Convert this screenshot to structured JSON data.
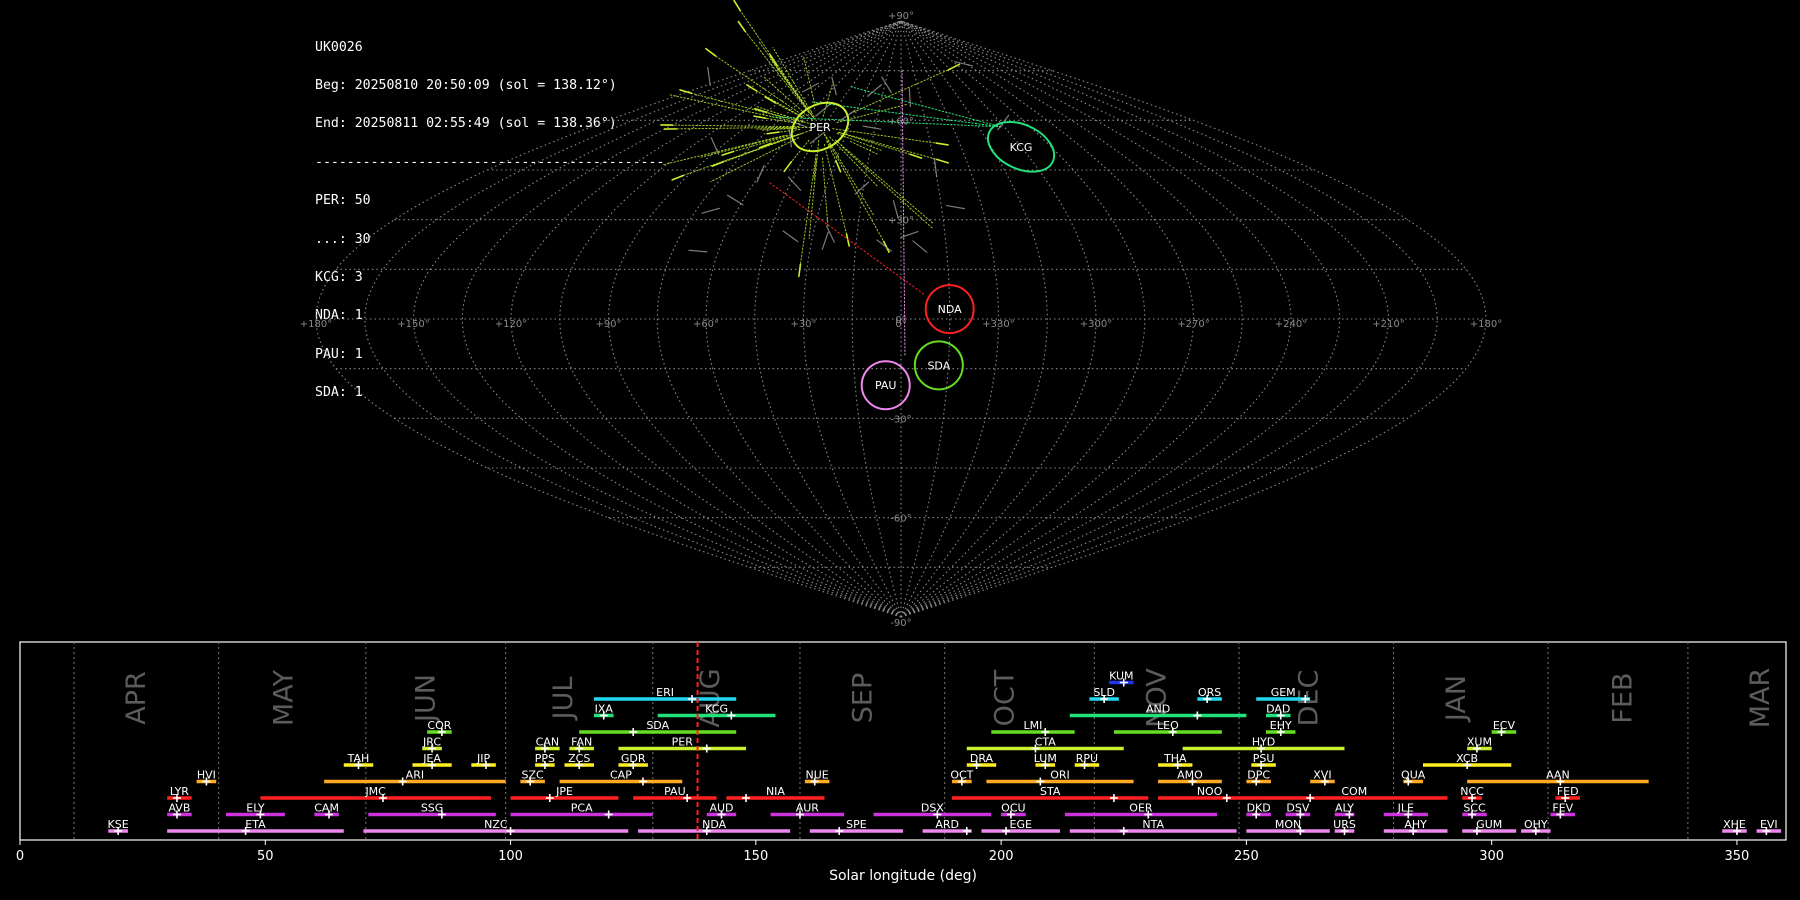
{
  "info": {
    "station": "UK0026",
    "begin": "Beg: 20250810 20:50:09 (sol = 138.12°)",
    "end": "End: 20250811 02:55:49 (sol = 138.36°)",
    "separator": "--------------------------------------------",
    "counts": [
      "PER: 50",
      "...: 30",
      "KCG: 3",
      "NDA: 1",
      "PAU: 1",
      "SDA: 1"
    ]
  },
  "sky_map": {
    "projection": "sinusoidal",
    "lat_labels": [
      "+90°",
      "+60°",
      "+30°",
      "0°",
      "-30°",
      "-60°",
      "-90°"
    ],
    "lon_labels": [
      "+180°",
      "+150°",
      "+120°",
      "+90°",
      "+60°",
      "+30°",
      "0°",
      "+330°",
      "+300°",
      "+270°",
      "+240°",
      "+210°",
      "+180°"
    ],
    "radiants": [
      {
        "name": "PER",
        "color": "#c8f02c",
        "lon": 47,
        "lat": 58
      },
      {
        "name": "KCG",
        "color": "#22e07a",
        "lon": 300,
        "lat": 52
      },
      {
        "name": "NDA",
        "color": "#ff2020",
        "lon": 345,
        "lat": 3
      },
      {
        "name": "SDA",
        "color": "#66dd22",
        "lon": 348,
        "lat": -14
      },
      {
        "name": "PAU",
        "color": "#ee88ee",
        "lon": 5,
        "lat": -20
      }
    ]
  },
  "chart_data": {
    "type": "timeline",
    "xlabel": "Solar longitude (deg)",
    "xlim": [
      0,
      360
    ],
    "xticks": [
      "0",
      "50",
      "100",
      "150",
      "200",
      "250",
      "300",
      "350"
    ],
    "current_sol": 138.12,
    "months": [
      {
        "label": "APR",
        "sol": 24
      },
      {
        "label": "MAY",
        "sol": 54
      },
      {
        "label": "JUN",
        "sol": 83
      },
      {
        "label": "JUL",
        "sol": 111
      },
      {
        "label": "AUG",
        "sol": 141
      },
      {
        "label": "SEP",
        "sol": 172
      },
      {
        "label": "OCT",
        "sol": 201
      },
      {
        "label": "NOV",
        "sol": 232
      },
      {
        "label": "DEC",
        "sol": 263
      },
      {
        "label": "JAN",
        "sol": 293
      },
      {
        "label": "FEB",
        "sol": 327
      },
      {
        "label": "MAR",
        "sol": 355
      }
    ],
    "month_bounds": [
      11,
      40.5,
      70.5,
      99,
      129,
      159,
      188.5,
      219,
      248.5,
      280,
      311.5,
      340
    ],
    "showers": [
      {
        "name": "KUM",
        "start": 222,
        "end": 227,
        "peak": 225,
        "row": 10,
        "color": "#2233ee"
      },
      {
        "name": "ERI",
        "start": 117,
        "end": 146,
        "peak": 137,
        "row": 9,
        "color": "#22d8f0"
      },
      {
        "name": "SLD",
        "start": 218,
        "end": 224,
        "peak": 221,
        "row": 9,
        "color": "#22d8f0"
      },
      {
        "name": "ORS",
        "start": 240,
        "end": 245,
        "peak": 242,
        "row": 9,
        "color": "#22d8f0"
      },
      {
        "name": "GEM",
        "start": 252,
        "end": 263,
        "peak": 262,
        "row": 9,
        "color": "#22d8f0"
      },
      {
        "name": "IXA",
        "start": 117,
        "end": 121,
        "peak": 119,
        "row": 8,
        "color": "#22e07a"
      },
      {
        "name": "KCG",
        "start": 130,
        "end": 154,
        "peak": 145,
        "row": 8,
        "color": "#22e07a"
      },
      {
        "name": "AND",
        "start": 214,
        "end": 250,
        "peak": 240,
        "row": 8,
        "color": "#22e07a"
      },
      {
        "name": "DAD",
        "start": 254,
        "end": 259,
        "peak": 257,
        "row": 8,
        "color": "#22e07a"
      },
      {
        "name": "COR",
        "start": 83,
        "end": 88,
        "peak": 86,
        "row": 7,
        "color": "#66dd22"
      },
      {
        "name": "SDA",
        "start": 114,
        "end": 146,
        "peak": 125,
        "row": 7,
        "color": "#66dd22"
      },
      {
        "name": "LMI",
        "start": 198,
        "end": 215,
        "peak": 209,
        "row": 7,
        "color": "#66dd22"
      },
      {
        "name": "LEO",
        "start": 223,
        "end": 245,
        "peak": 235,
        "row": 7,
        "color": "#66dd22"
      },
      {
        "name": "EHY",
        "start": 254,
        "end": 260,
        "peak": 257,
        "row": 7,
        "color": "#66dd22"
      },
      {
        "name": "ECV",
        "start": 300,
        "end": 305,
        "peak": 302,
        "row": 7,
        "color": "#66dd22"
      },
      {
        "name": "JRC",
        "start": 82,
        "end": 86,
        "peak": 84,
        "row": 6,
        "color": "#c8f02c"
      },
      {
        "name": "CAN",
        "start": 105,
        "end": 110,
        "peak": 107,
        "row": 6,
        "color": "#c8f02c"
      },
      {
        "name": "FAN",
        "start": 112,
        "end": 117,
        "peak": 114,
        "row": 6,
        "color": "#c8f02c"
      },
      {
        "name": "PER",
        "start": 122,
        "end": 148,
        "peak": 140,
        "row": 6,
        "color": "#c8f02c"
      },
      {
        "name": "CTA",
        "start": 193,
        "end": 225,
        "peak": 207,
        "row": 6,
        "color": "#c8f02c"
      },
      {
        "name": "HYD",
        "start": 237,
        "end": 270,
        "peak": 253,
        "row": 6,
        "color": "#c8f02c"
      },
      {
        "name": "XUM",
        "start": 295,
        "end": 300,
        "peak": 297,
        "row": 6,
        "color": "#c8f02c"
      },
      {
        "name": "TAH",
        "start": 66,
        "end": 72,
        "peak": 69,
        "row": 5,
        "color": "#ffee22"
      },
      {
        "name": "JEA",
        "start": 80,
        "end": 88,
        "peak": 84,
        "row": 5,
        "color": "#ffee22"
      },
      {
        "name": "JIP",
        "start": 92,
        "end": 97,
        "peak": 95,
        "row": 5,
        "color": "#ffee22"
      },
      {
        "name": "PPS",
        "start": 105,
        "end": 109,
        "peak": 107,
        "row": 5,
        "color": "#ffee22"
      },
      {
        "name": "ZCS",
        "start": 111,
        "end": 117,
        "peak": 114,
        "row": 5,
        "color": "#ffee22"
      },
      {
        "name": "GDR",
        "start": 122,
        "end": 128,
        "peak": 125,
        "row": 5,
        "color": "#ffee22"
      },
      {
        "name": "DRA",
        "start": 193,
        "end": 199,
        "peak": 195,
        "row": 5,
        "color": "#ffee22"
      },
      {
        "name": "LUM",
        "start": 207,
        "end": 211,
        "peak": 209,
        "row": 5,
        "color": "#ffee22"
      },
      {
        "name": "RPU",
        "start": 215,
        "end": 220,
        "peak": 217,
        "row": 5,
        "color": "#ffee22"
      },
      {
        "name": "THA",
        "start": 232,
        "end": 239,
        "peak": 236,
        "row": 5,
        "color": "#ffee22"
      },
      {
        "name": "PSU",
        "start": 251,
        "end": 256,
        "peak": 253,
        "row": 5,
        "color": "#ffee22"
      },
      {
        "name": "XCB",
        "start": 286,
        "end": 304,
        "peak": 295,
        "row": 5,
        "color": "#ffee22"
      },
      {
        "name": "HVI",
        "start": 36,
        "end": 40,
        "peak": 38,
        "row": 4,
        "color": "#ffaa22"
      },
      {
        "name": "ARI",
        "start": 62,
        "end": 99,
        "peak": 78,
        "row": 4,
        "color": "#ffaa22"
      },
      {
        "name": "SZC",
        "start": 102,
        "end": 107,
        "peak": 104,
        "row": 4,
        "color": "#ffaa22"
      },
      {
        "name": "CAP",
        "start": 110,
        "end": 135,
        "peak": 127,
        "row": 4,
        "color": "#ffaa22"
      },
      {
        "name": "NUE",
        "start": 160,
        "end": 165,
        "peak": 162,
        "row": 4,
        "color": "#ffaa22"
      },
      {
        "name": "OCT",
        "start": 190,
        "end": 194,
        "peak": 192,
        "row": 4,
        "color": "#ffaa22"
      },
      {
        "name": "ORI",
        "start": 197,
        "end": 227,
        "peak": 208,
        "row": 4,
        "color": "#ffaa22"
      },
      {
        "name": "AMO",
        "start": 232,
        "end": 245,
        "peak": 239,
        "row": 4,
        "color": "#ffaa22"
      },
      {
        "name": "DPC",
        "start": 250,
        "end": 255,
        "peak": 252,
        "row": 4,
        "color": "#ffaa22"
      },
      {
        "name": "XVI",
        "start": 263,
        "end": 268,
        "peak": 266,
        "row": 4,
        "color": "#ffaa22"
      },
      {
        "name": "QUA",
        "start": 282,
        "end": 286,
        "peak": 283,
        "row": 4,
        "color": "#ffaa22"
      },
      {
        "name": "AAN",
        "start": 295,
        "end": 332,
        "peak": 314,
        "row": 4,
        "color": "#ffaa22"
      },
      {
        "name": "LYR",
        "start": 30,
        "end": 35,
        "peak": 32,
        "row": 3,
        "color": "#ff2020"
      },
      {
        "name": "JMC",
        "start": 49,
        "end": 96,
        "peak": 74,
        "row": 3,
        "color": "#ff2020"
      },
      {
        "name": "JPE",
        "start": 100,
        "end": 122,
        "peak": 108,
        "row": 3,
        "color": "#ff2020"
      },
      {
        "name": "PAU",
        "start": 125,
        "end": 142,
        "peak": 136,
        "row": 3,
        "color": "#ff2020"
      },
      {
        "name": "NIA",
        "start": 144,
        "end": 164,
        "peak": 148,
        "row": 3,
        "color": "#ff2020"
      },
      {
        "name": "STA",
        "start": 190,
        "end": 230,
        "peak": 223,
        "row": 3,
        "color": "#ff2020"
      },
      {
        "name": "NOO",
        "start": 232,
        "end": 253,
        "peak": 246,
        "row": 3,
        "color": "#ff2020"
      },
      {
        "name": "COM",
        "start": 253,
        "end": 291,
        "peak": 263,
        "row": 3,
        "color": "#ff2020"
      },
      {
        "name": "NCC",
        "start": 294,
        "end": 298,
        "peak": 296,
        "row": 3,
        "color": "#ff2020"
      },
      {
        "name": "FED",
        "start": 313,
        "end": 318,
        "peak": 315,
        "row": 3,
        "color": "#ff2020"
      },
      {
        "name": "AVB",
        "start": 30,
        "end": 35,
        "peak": 32,
        "row": 2,
        "color": "#cc33dd"
      },
      {
        "name": "ELY",
        "start": 42,
        "end": 54,
        "peak": 49,
        "row": 2,
        "color": "#cc33dd"
      },
      {
        "name": "CAM",
        "start": 60,
        "end": 65,
        "peak": 63,
        "row": 2,
        "color": "#cc33dd"
      },
      {
        "name": "SSG",
        "start": 71,
        "end": 97,
        "peak": 86,
        "row": 2,
        "color": "#cc33dd"
      },
      {
        "name": "PCA",
        "start": 100,
        "end": 129,
        "peak": 120,
        "row": 2,
        "color": "#cc33dd"
      },
      {
        "name": "AUD",
        "start": 140,
        "end": 146,
        "peak": 143,
        "row": 2,
        "color": "#cc33dd"
      },
      {
        "name": "AUR",
        "start": 153,
        "end": 168,
        "peak": 159,
        "row": 2,
        "color": "#cc33dd"
      },
      {
        "name": "DSX",
        "start": 174,
        "end": 198,
        "peak": 187,
        "row": 2,
        "color": "#cc33dd"
      },
      {
        "name": "OCU",
        "start": 200,
        "end": 205,
        "peak": 202,
        "row": 2,
        "color": "#cc33dd"
      },
      {
        "name": "OER",
        "start": 213,
        "end": 244,
        "peak": 230,
        "row": 2,
        "color": "#cc33dd"
      },
      {
        "name": "DKD",
        "start": 250,
        "end": 255,
        "peak": 252,
        "row": 2,
        "color": "#cc33dd"
      },
      {
        "name": "DSV",
        "start": 258,
        "end": 263,
        "peak": 261,
        "row": 2,
        "color": "#cc33dd"
      },
      {
        "name": "ALY",
        "start": 268,
        "end": 272,
        "peak": 271,
        "row": 2,
        "color": "#cc33dd"
      },
      {
        "name": "JLE",
        "start": 278,
        "end": 287,
        "peak": 283,
        "row": 2,
        "color": "#cc33dd"
      },
      {
        "name": "SCC",
        "start": 294,
        "end": 299,
        "peak": 296,
        "row": 2,
        "color": "#cc33dd"
      },
      {
        "name": "FEV",
        "start": 312,
        "end": 317,
        "peak": 314,
        "row": 2,
        "color": "#cc33dd"
      },
      {
        "name": "KSE",
        "start": 18,
        "end": 22,
        "peak": 20,
        "row": 1,
        "color": "#ee88ee"
      },
      {
        "name": "ETA",
        "start": 30,
        "end": 66,
        "peak": 46,
        "row": 1,
        "color": "#ee88ee"
      },
      {
        "name": "NZC",
        "start": 70,
        "end": 124,
        "peak": 100,
        "row": 1,
        "color": "#ee88ee"
      },
      {
        "name": "NDA",
        "start": 126,
        "end": 157,
        "peak": 140,
        "row": 1,
        "color": "#ee88ee"
      },
      {
        "name": "SPE",
        "start": 161,
        "end": 180,
        "peak": 167,
        "row": 1,
        "color": "#ee88ee"
      },
      {
        "name": "ARD",
        "start": 184,
        "end": 194,
        "peak": 193,
        "row": 1,
        "color": "#ee88ee"
      },
      {
        "name": "EGE",
        "start": 196,
        "end": 212,
        "peak": 201,
        "row": 1,
        "color": "#ee88ee"
      },
      {
        "name": "NTA",
        "start": 214,
        "end": 248,
        "peak": 225,
        "row": 1,
        "color": "#ee88ee"
      },
      {
        "name": "MON",
        "start": 250,
        "end": 267,
        "peak": 261,
        "row": 1,
        "color": "#ee88ee"
      },
      {
        "name": "URS",
        "start": 268,
        "end": 272,
        "peak": 270,
        "row": 1,
        "color": "#ee88ee"
      },
      {
        "name": "AHY",
        "start": 278,
        "end": 291,
        "peak": 284,
        "row": 1,
        "color": "#ee88ee"
      },
      {
        "name": "GUM",
        "start": 294,
        "end": 305,
        "peak": 297,
        "row": 1,
        "color": "#ee88ee"
      },
      {
        "name": "OHY",
        "start": 306,
        "end": 312,
        "peak": 309,
        "row": 1,
        "color": "#ee88ee"
      },
      {
        "name": "XHE",
        "start": 347,
        "end": 352,
        "peak": 350,
        "row": 1,
        "color": "#ee88ee"
      },
      {
        "name": "EVI",
        "start": 354,
        "end": 359,
        "peak": 356,
        "row": 1,
        "color": "#ee88ee"
      }
    ]
  }
}
